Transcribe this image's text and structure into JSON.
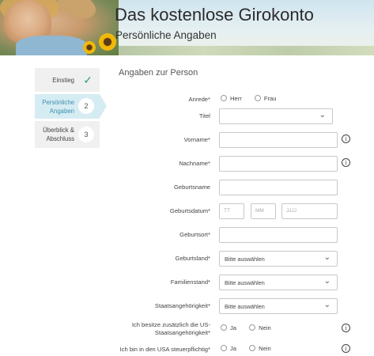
{
  "header": {
    "title": "Das kostenlose Girokonto",
    "subtitle": "Persönliche Angaben"
  },
  "steps": [
    {
      "label": "Einstieg",
      "state": "done"
    },
    {
      "label_line1": "Persönliche",
      "label_line2": "Angaben",
      "number": "2",
      "state": "active"
    },
    {
      "label_line1": "Überblick &",
      "label_line2": "Abschluss",
      "number": "3",
      "state": "pending"
    }
  ],
  "form": {
    "section_title": "Angaben zur Person",
    "anrede": {
      "label": "Anrede*",
      "options": [
        "Herr",
        "Frau"
      ]
    },
    "titel": {
      "label": "Titel",
      "value": ""
    },
    "vorname": {
      "label": "Vorname*",
      "value": ""
    },
    "nachname": {
      "label": "Nachname*",
      "value": ""
    },
    "geburtsname": {
      "label": "Geburtsname",
      "value": ""
    },
    "geburtsdatum": {
      "label": "Geburtsdatum*",
      "day_placeholder": "TT",
      "month_placeholder": "MM",
      "year_placeholder": "JJJJ"
    },
    "geburtsort": {
      "label": "Geburtsort*",
      "value": ""
    },
    "geburtsland": {
      "label": "Geburtsland*",
      "value": "Bitte auswählen"
    },
    "familienstand": {
      "label": "Familienstand*",
      "value": "Bitte auswählen"
    },
    "staatsangehoerigkeit": {
      "label": "Staatsangehörigkeit*",
      "value": "Bitte auswählen"
    },
    "us_staatsangehoerigkeit": {
      "label_line1": "Ich besitze zusätzlich die US-",
      "label_line2": "Staatsangehörigkeit*",
      "options": [
        "Ja",
        "Nein"
      ]
    },
    "us_steuerpflicht": {
      "label": "Ich bin in den USA steuerpflichtig*",
      "options": [
        "Ja",
        "Nein"
      ]
    }
  },
  "icons": {
    "info": "info-icon",
    "check": "checkmark-icon",
    "chevron": "chevron-down-icon"
  },
  "colors": {
    "accent": "#3c8fb0",
    "check": "#2f9a8f",
    "active_step_bg": "#d6ecf3",
    "step_bg": "#f0f0f0"
  }
}
